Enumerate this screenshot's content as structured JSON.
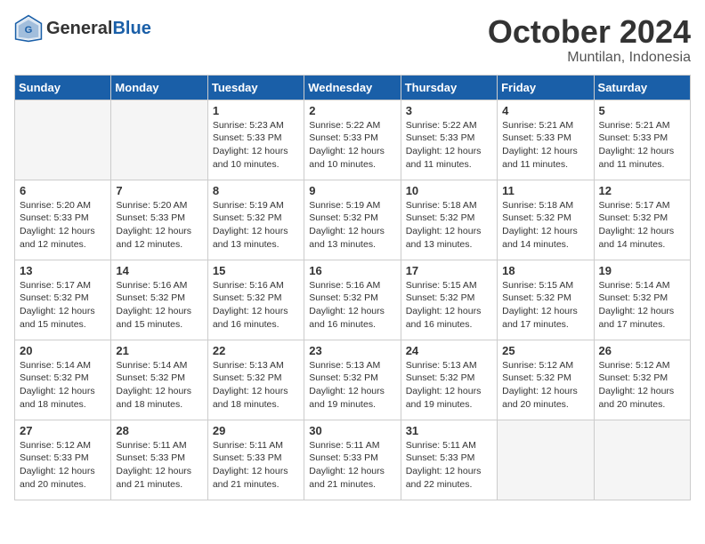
{
  "header": {
    "logo_general": "General",
    "logo_blue": "Blue",
    "month_title": "October 2024",
    "location": "Muntilan, Indonesia"
  },
  "days_of_week": [
    "Sunday",
    "Monday",
    "Tuesday",
    "Wednesday",
    "Thursday",
    "Friday",
    "Saturday"
  ],
  "weeks": [
    [
      {
        "day": "",
        "info": ""
      },
      {
        "day": "",
        "info": ""
      },
      {
        "day": "1",
        "info": "Sunrise: 5:23 AM\nSunset: 5:33 PM\nDaylight: 12 hours\nand 10 minutes."
      },
      {
        "day": "2",
        "info": "Sunrise: 5:22 AM\nSunset: 5:33 PM\nDaylight: 12 hours\nand 10 minutes."
      },
      {
        "day": "3",
        "info": "Sunrise: 5:22 AM\nSunset: 5:33 PM\nDaylight: 12 hours\nand 11 minutes."
      },
      {
        "day": "4",
        "info": "Sunrise: 5:21 AM\nSunset: 5:33 PM\nDaylight: 12 hours\nand 11 minutes."
      },
      {
        "day": "5",
        "info": "Sunrise: 5:21 AM\nSunset: 5:33 PM\nDaylight: 12 hours\nand 11 minutes."
      }
    ],
    [
      {
        "day": "6",
        "info": "Sunrise: 5:20 AM\nSunset: 5:33 PM\nDaylight: 12 hours\nand 12 minutes."
      },
      {
        "day": "7",
        "info": "Sunrise: 5:20 AM\nSunset: 5:33 PM\nDaylight: 12 hours\nand 12 minutes."
      },
      {
        "day": "8",
        "info": "Sunrise: 5:19 AM\nSunset: 5:32 PM\nDaylight: 12 hours\nand 13 minutes."
      },
      {
        "day": "9",
        "info": "Sunrise: 5:19 AM\nSunset: 5:32 PM\nDaylight: 12 hours\nand 13 minutes."
      },
      {
        "day": "10",
        "info": "Sunrise: 5:18 AM\nSunset: 5:32 PM\nDaylight: 12 hours\nand 13 minutes."
      },
      {
        "day": "11",
        "info": "Sunrise: 5:18 AM\nSunset: 5:32 PM\nDaylight: 12 hours\nand 14 minutes."
      },
      {
        "day": "12",
        "info": "Sunrise: 5:17 AM\nSunset: 5:32 PM\nDaylight: 12 hours\nand 14 minutes."
      }
    ],
    [
      {
        "day": "13",
        "info": "Sunrise: 5:17 AM\nSunset: 5:32 PM\nDaylight: 12 hours\nand 15 minutes."
      },
      {
        "day": "14",
        "info": "Sunrise: 5:16 AM\nSunset: 5:32 PM\nDaylight: 12 hours\nand 15 minutes."
      },
      {
        "day": "15",
        "info": "Sunrise: 5:16 AM\nSunset: 5:32 PM\nDaylight: 12 hours\nand 16 minutes."
      },
      {
        "day": "16",
        "info": "Sunrise: 5:16 AM\nSunset: 5:32 PM\nDaylight: 12 hours\nand 16 minutes."
      },
      {
        "day": "17",
        "info": "Sunrise: 5:15 AM\nSunset: 5:32 PM\nDaylight: 12 hours\nand 16 minutes."
      },
      {
        "day": "18",
        "info": "Sunrise: 5:15 AM\nSunset: 5:32 PM\nDaylight: 12 hours\nand 17 minutes."
      },
      {
        "day": "19",
        "info": "Sunrise: 5:14 AM\nSunset: 5:32 PM\nDaylight: 12 hours\nand 17 minutes."
      }
    ],
    [
      {
        "day": "20",
        "info": "Sunrise: 5:14 AM\nSunset: 5:32 PM\nDaylight: 12 hours\nand 18 minutes."
      },
      {
        "day": "21",
        "info": "Sunrise: 5:14 AM\nSunset: 5:32 PM\nDaylight: 12 hours\nand 18 minutes."
      },
      {
        "day": "22",
        "info": "Sunrise: 5:13 AM\nSunset: 5:32 PM\nDaylight: 12 hours\nand 18 minutes."
      },
      {
        "day": "23",
        "info": "Sunrise: 5:13 AM\nSunset: 5:32 PM\nDaylight: 12 hours\nand 19 minutes."
      },
      {
        "day": "24",
        "info": "Sunrise: 5:13 AM\nSunset: 5:32 PM\nDaylight: 12 hours\nand 19 minutes."
      },
      {
        "day": "25",
        "info": "Sunrise: 5:12 AM\nSunset: 5:32 PM\nDaylight: 12 hours\nand 20 minutes."
      },
      {
        "day": "26",
        "info": "Sunrise: 5:12 AM\nSunset: 5:32 PM\nDaylight: 12 hours\nand 20 minutes."
      }
    ],
    [
      {
        "day": "27",
        "info": "Sunrise: 5:12 AM\nSunset: 5:33 PM\nDaylight: 12 hours\nand 20 minutes."
      },
      {
        "day": "28",
        "info": "Sunrise: 5:11 AM\nSunset: 5:33 PM\nDaylight: 12 hours\nand 21 minutes."
      },
      {
        "day": "29",
        "info": "Sunrise: 5:11 AM\nSunset: 5:33 PM\nDaylight: 12 hours\nand 21 minutes."
      },
      {
        "day": "30",
        "info": "Sunrise: 5:11 AM\nSunset: 5:33 PM\nDaylight: 12 hours\nand 21 minutes."
      },
      {
        "day": "31",
        "info": "Sunrise: 5:11 AM\nSunset: 5:33 PM\nDaylight: 12 hours\nand 22 minutes."
      },
      {
        "day": "",
        "info": ""
      },
      {
        "day": "",
        "info": ""
      }
    ]
  ]
}
